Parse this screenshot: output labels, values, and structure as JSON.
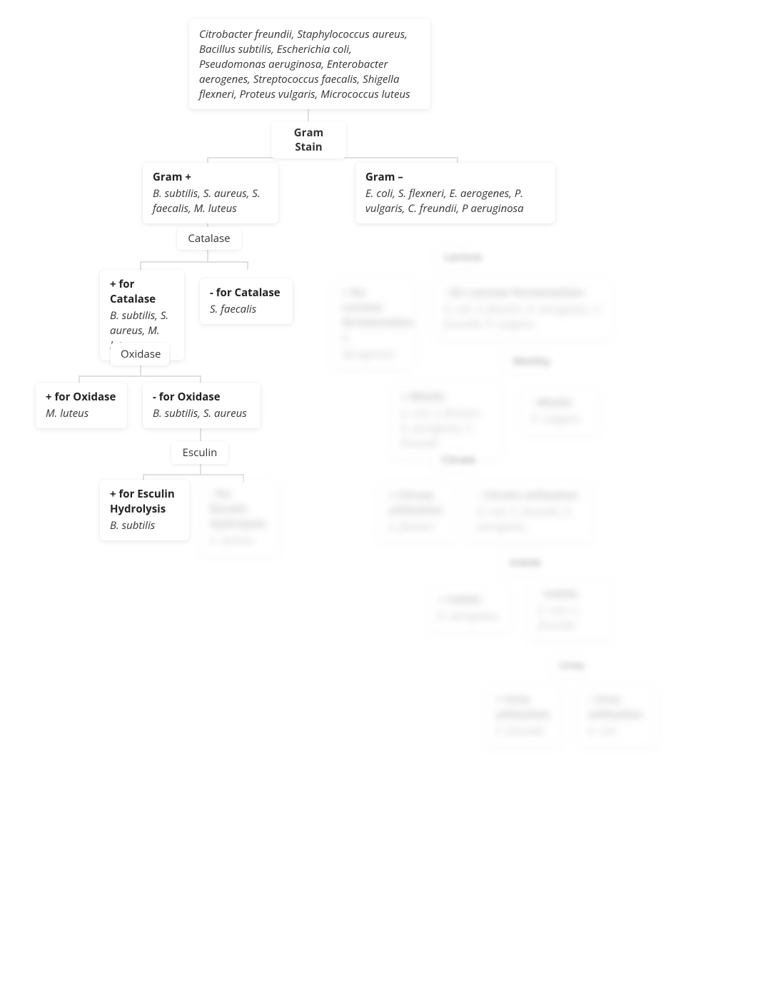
{
  "root": {
    "sub": "Citrobacter freundii, Staphylococcus aureus, Bacillus subtilis, Escherichia coli, Pseudomonas aeruginosa, Enterobacter aerogenes, Streptococcus faecalis, Shigella flexneri, Proteus vulgaris, Micrococcus luteus"
  },
  "tests": {
    "gram_stain": "Gram Stain",
    "catalase": "Catalase",
    "oxidase": "Oxidase",
    "esculin": "Esculin",
    "gram_neg_test1": "Lactose",
    "gram_neg_test2": "Motility",
    "gram_neg_test3": "Citrate",
    "gram_neg_test4": "Indole",
    "gram_neg_test5": "Urea"
  },
  "gram_pos": {
    "title": "Gram +",
    "sub": "B. subtilis, S. aureus, S. faecalis, M. luteus"
  },
  "gram_neg": {
    "title": "Gram –",
    "sub": "E. coli, S. flexneri, E. aerogenes, P. vulgaris, C. freundii, P aeruginosa"
  },
  "cat_pos": {
    "title": "+ for Catalase",
    "sub": "B. subtilis, S. aureus, M. luteus"
  },
  "cat_neg": {
    "title": "- for Catalase",
    "sub": "S. faecalis"
  },
  "oxi_pos": {
    "title": "+ for Oxidase",
    "sub": "M. luteus"
  },
  "oxi_neg": {
    "title": "- for Oxidase",
    "sub": "B. subtilis, S. aureus"
  },
  "esc_pos": {
    "title": "+ for Esculin Hydrolysis",
    "sub": "B. subtilis"
  },
  "esc_neg": {
    "title": "- for Esculin Hydrolysis",
    "sub": "S. aureus"
  },
  "neg_a": {
    "title": "+ for Lactose fermentation",
    "sub": "P. aeruginosa"
  },
  "neg_b": {
    "title": "- for Lactose fermentation",
    "sub": "E. coli, S. flexneri, E. aerogenes, C. freundii, P. vulgaris"
  },
  "neg_c": {
    "title": "+ Motile",
    "sub": "E. coli, S. flexneri, E. aerogenes, C. freundii"
  },
  "neg_d": {
    "title": "- Motile",
    "sub": "P. vulgaris"
  },
  "neg_e": {
    "title": "+ Citrate utilization",
    "sub": "S. flexneri"
  },
  "neg_f": {
    "title": "- Citrate utilization",
    "sub": "E. coli, C. freundii, E. aerogenes"
  },
  "neg_g": {
    "title": "+ Indole",
    "sub": "E. aerogenes"
  },
  "neg_h": {
    "title": "- Indole",
    "sub": "E. coli, C. freundii"
  },
  "neg_i": {
    "title": "+ Urea utilization",
    "sub": "C. freundii"
  },
  "neg_j": {
    "title": "- Urea utilization",
    "sub": "E. coli"
  }
}
